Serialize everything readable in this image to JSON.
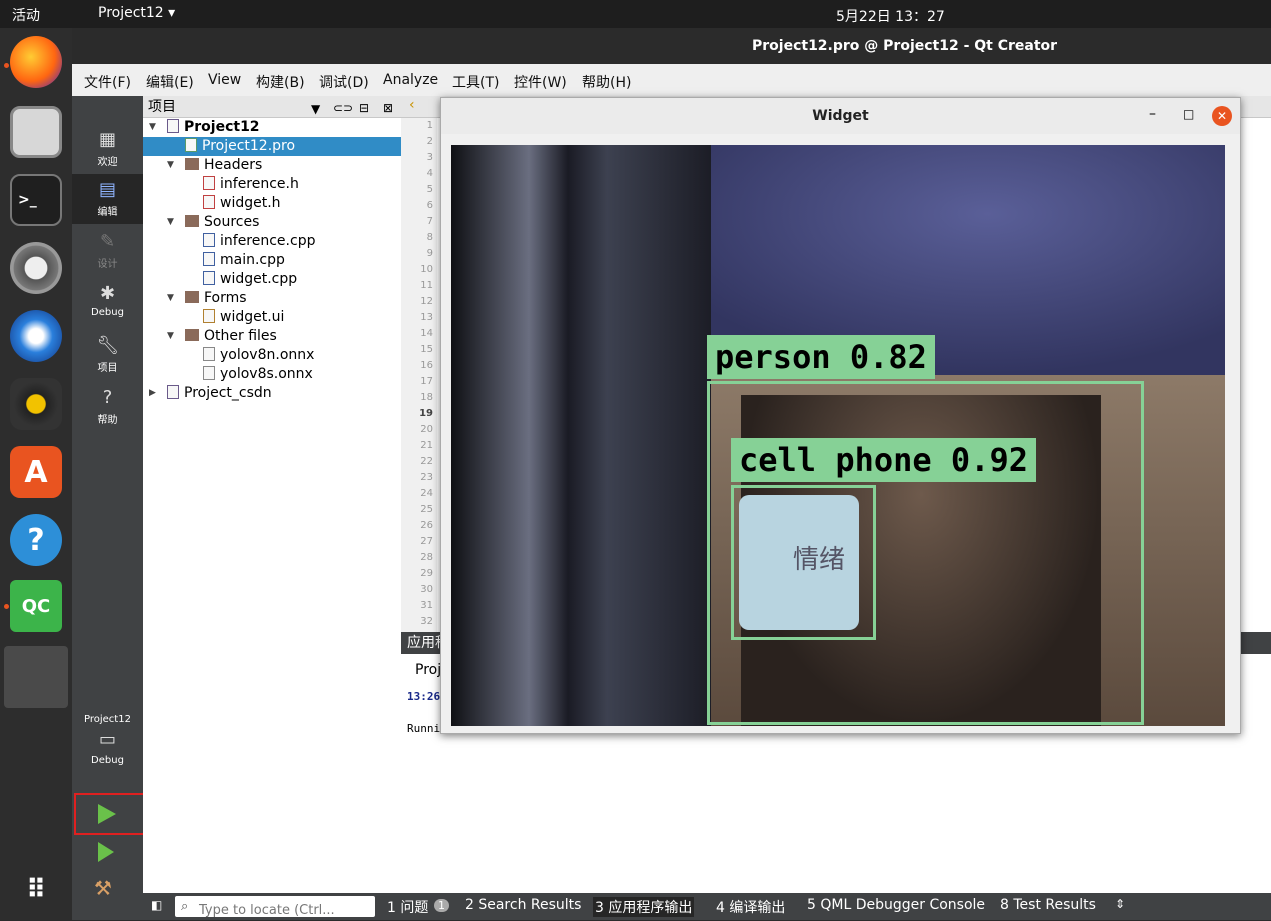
{
  "topbar": {
    "activities": "活动",
    "app": "Project12 ▾",
    "clock": "5月22日  13：27"
  },
  "window": {
    "title": "Project12.pro @ Project12 - Qt Creator"
  },
  "menu": [
    "文件(F)",
    "编辑(E)",
    "View",
    "构建(B)",
    "调试(D)",
    "Analyze",
    "工具(T)",
    "控件(W)",
    "帮助(H)"
  ],
  "modes": [
    "欢迎",
    "编辑",
    "设计",
    "Debug",
    "项目",
    "帮助"
  ],
  "kit": {
    "project": "Project12",
    "config": "Debug"
  },
  "tree": {
    "header": "项目",
    "items": [
      {
        "label": "Project12",
        "indent": 0,
        "type": "project",
        "bold": true
      },
      {
        "label": "Project12.pro",
        "indent": 1,
        "type": "pro",
        "selected": true
      },
      {
        "label": "Headers",
        "indent": 1,
        "type": "folder"
      },
      {
        "label": "inference.h",
        "indent": 2,
        "type": "h"
      },
      {
        "label": "widget.h",
        "indent": 2,
        "type": "h"
      },
      {
        "label": "Sources",
        "indent": 1,
        "type": "folder"
      },
      {
        "label": "inference.cpp",
        "indent": 2,
        "type": "cpp"
      },
      {
        "label": "main.cpp",
        "indent": 2,
        "type": "cpp"
      },
      {
        "label": "widget.cpp",
        "indent": 2,
        "type": "cpp"
      },
      {
        "label": "Forms",
        "indent": 1,
        "type": "folder"
      },
      {
        "label": "widget.ui",
        "indent": 2,
        "type": "ui"
      },
      {
        "label": "Other files",
        "indent": 1,
        "type": "folder"
      },
      {
        "label": "yolov8n.onnx",
        "indent": 2,
        "type": "file"
      },
      {
        "label": "yolov8s.onnx",
        "indent": 2,
        "type": "file"
      },
      {
        "label": "Project_csdn",
        "indent": 0,
        "type": "project",
        "bold": false
      }
    ]
  },
  "lines": [
    "1",
    "2",
    "3",
    "4",
    "5",
    "6",
    "7",
    "8",
    "9",
    "10",
    "11",
    "12",
    "13",
    "14",
    "15",
    "16",
    "17",
    "18",
    "19",
    "20",
    "21",
    "22",
    "23",
    "24",
    "25",
    "26",
    "27",
    "28",
    "29",
    "30",
    "31",
    "32"
  ],
  "output": {
    "title": "应用程",
    "tab": "Proj",
    "time": "13:26",
    "running": "Runni"
  },
  "status": {
    "locate_placeholder": "Type to locate (Ctrl...",
    "tabs": [
      "1  问题",
      "2  Search Results",
      "3  应用程序输出",
      "4  编译输出",
      "5  QML Debugger Console",
      "8  Test Results"
    ],
    "badge": "1"
  },
  "widget": {
    "title": "Widget",
    "detections": [
      {
        "label": "person 0.82"
      },
      {
        "label": "cell phone 0.92"
      }
    ],
    "phone_text": "情绪"
  }
}
